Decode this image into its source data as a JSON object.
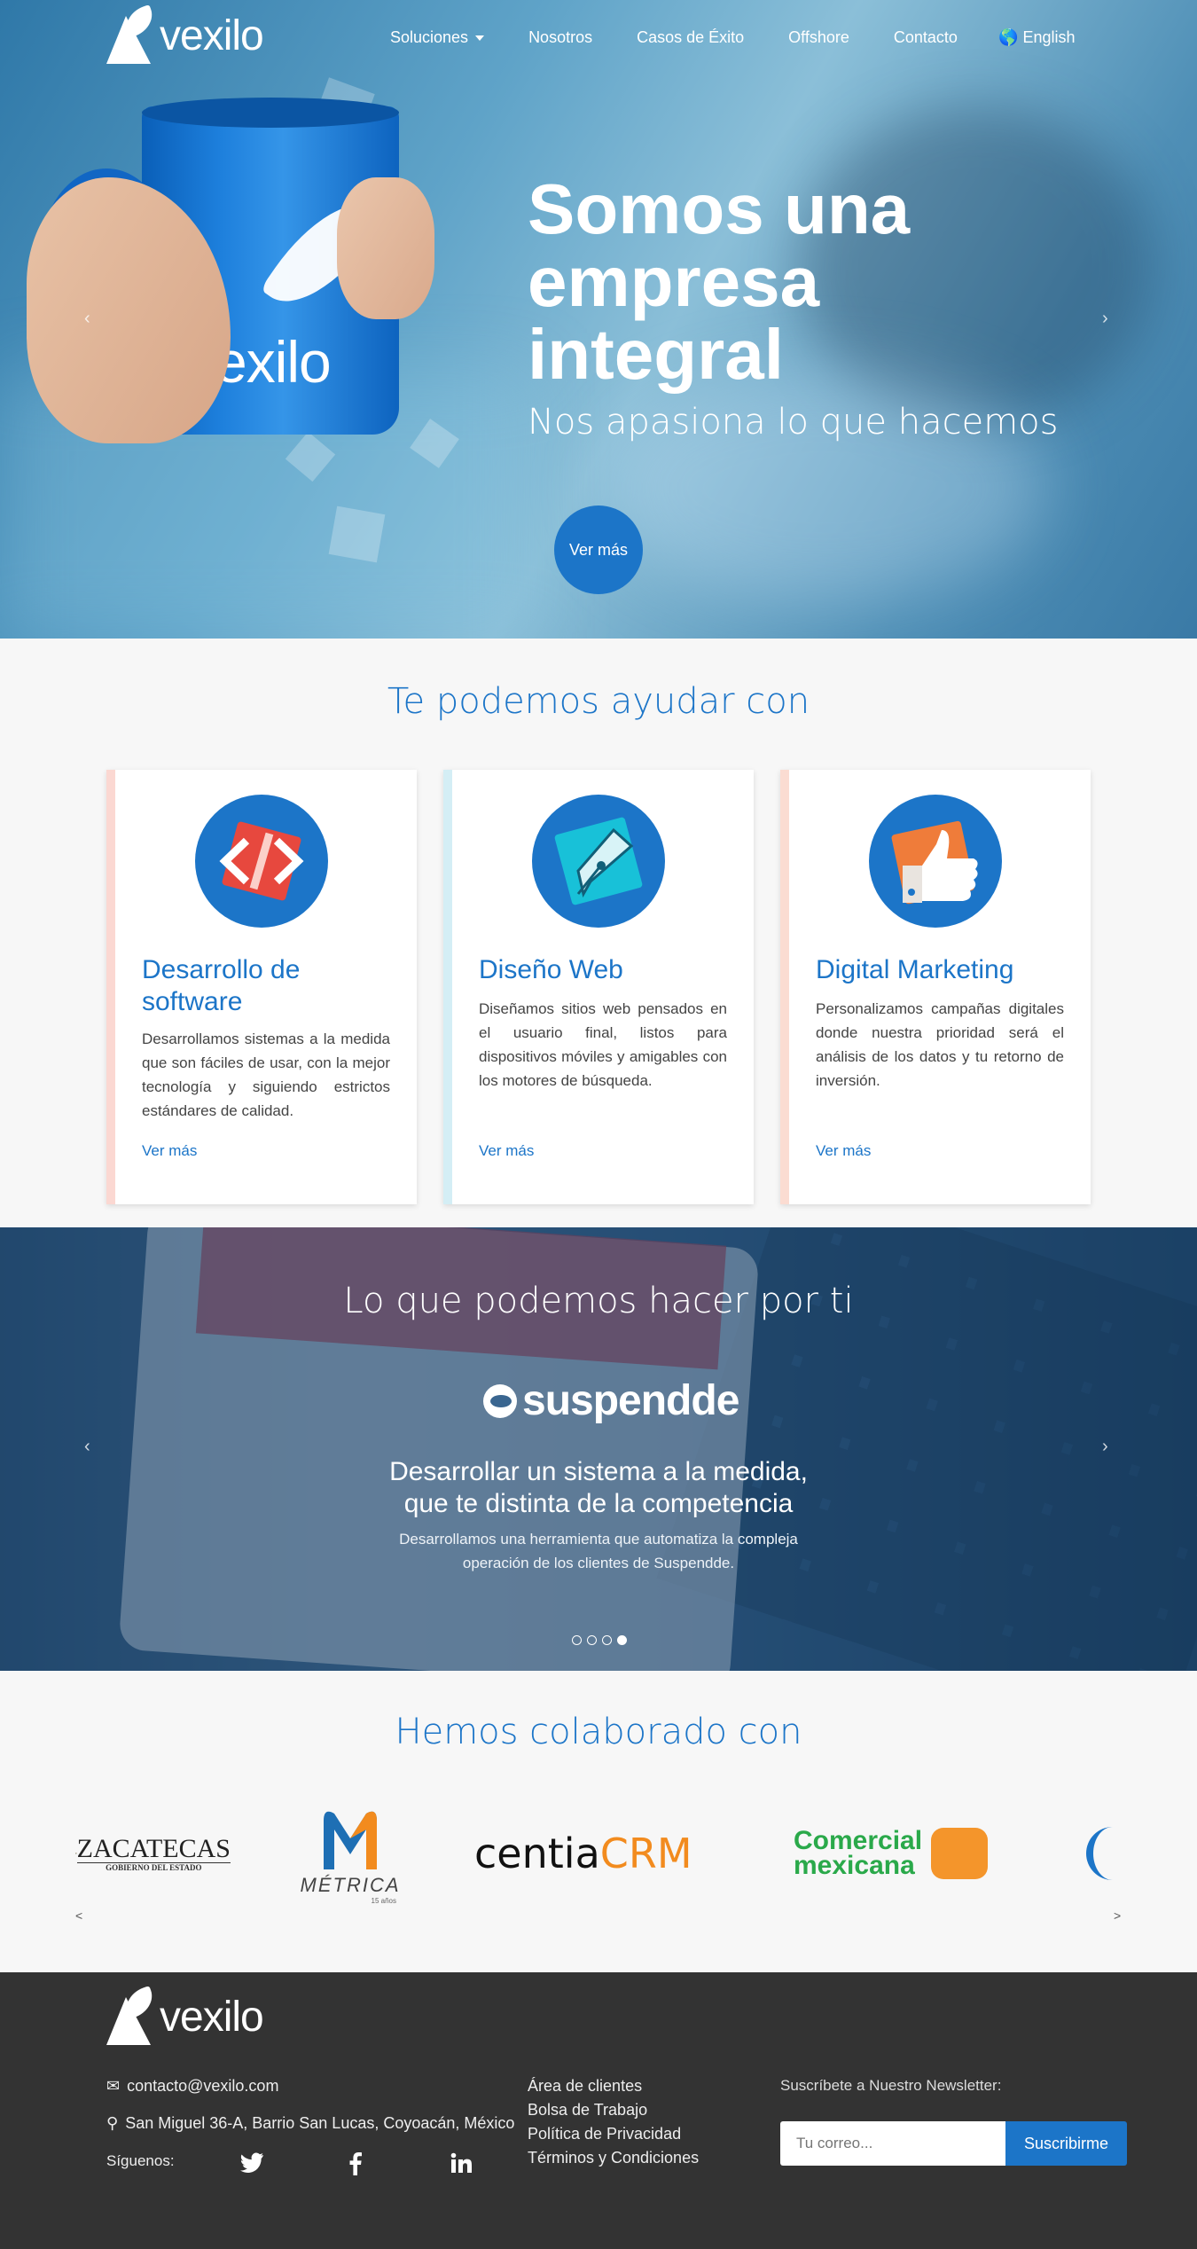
{
  "nav": {
    "brand": "vexilo",
    "items": [
      {
        "label": "Soluciones",
        "dropdown": true
      },
      {
        "label": "Nosotros"
      },
      {
        "label": "Casos de Éxito"
      },
      {
        "label": "Offshore"
      },
      {
        "label": "Contacto"
      }
    ],
    "language": "English"
  },
  "hero": {
    "title": "Somos una empresa integral",
    "subtitle": "Nos apasiona lo que hacemos",
    "button": "Ver más",
    "mug_text": "vexilo",
    "prev": "‹",
    "next": "›"
  },
  "services": {
    "title": "Te podemos ayudar con",
    "cards": [
      {
        "title": "Desarrollo de software",
        "text": "Desarrollamos sistemas a la medida que son fáciles de usar, con la mejor tecnología y siguiendo estrictos estándares de calidad.",
        "link": "Ver más",
        "icon": "code-icon",
        "edge": "#fbd8d2"
      },
      {
        "title": "Diseño Web",
        "text": "Diseñamos sitios web pensados en el usuario final, listos para dispositivos móviles y amigables con los motores de búsqueda.",
        "link": "Ver más",
        "icon": "pen-nib-icon",
        "edge": "#d4eef5"
      },
      {
        "title": "Digital Marketing",
        "text": "Personalizamos campañas digitales donde nuestra prioridad será el análisis de los datos y tu retorno de inversión.",
        "link": "Ver más",
        "icon": "thumbs-up-icon",
        "edge": "#fbdcd2"
      }
    ]
  },
  "case": {
    "title": "Lo que podemos hacer por ti",
    "brand": "suspendde",
    "headline_1": "Desarrollar un sistema a la medida,",
    "headline_2": "que te distinta de la competencia",
    "desc_1": "Desarrollamos una herramienta que automatiza la compleja",
    "desc_2": "operación de los clientes de Suspendde.",
    "slides_total": 4,
    "slide_active": 4,
    "prev": "‹",
    "next": "›"
  },
  "clients": {
    "title": "Hemos colaborado con",
    "logos": [
      {
        "name": "ZACATECAS",
        "sub": "GOBIERNO DEL ESTADO"
      },
      {
        "name": "MÉTRICA",
        "sub": "15 años"
      },
      {
        "name_a": "centia",
        "name_b": "CRM"
      },
      {
        "name_a": "Comercial",
        "name_b": "mexicana"
      }
    ],
    "prev": "<",
    "next": ">"
  },
  "footer": {
    "brand": "vexilo",
    "email": "contacto@vexilo.com",
    "address": "San Miguel 36-A, Barrio San Lucas, Coyoacán, México",
    "follow": "Síguenos:",
    "links": [
      "Área de clientes",
      "Bolsa de Trabajo",
      "Política de Privacidad",
      "Términos y Condiciones"
    ],
    "newsletter_label": "Suscríbete a Nuestro Newsletter:",
    "newsletter_placeholder": "Tu correo...",
    "newsletter_button": "Suscribirme"
  },
  "colors": {
    "primary": "#1c75c8",
    "footer_bg": "#333333"
  }
}
